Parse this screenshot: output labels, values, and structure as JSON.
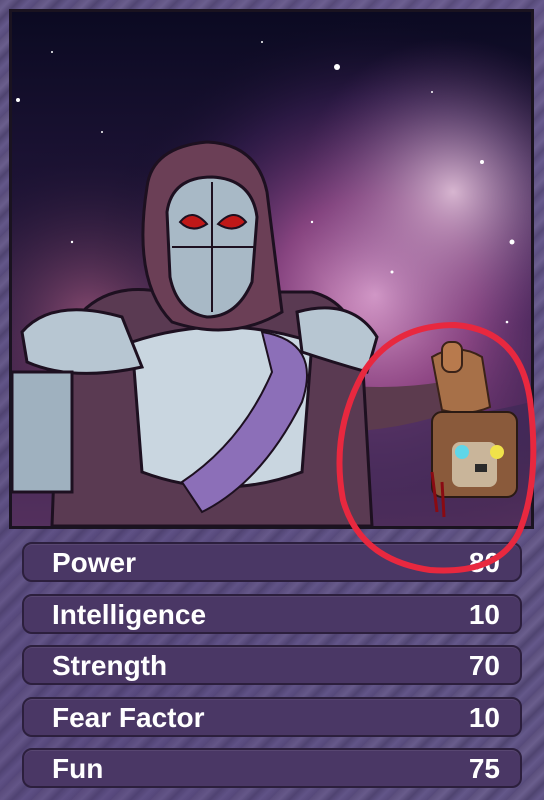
{
  "stats": [
    {
      "label": "Power",
      "value": "80"
    },
    {
      "label": "Intelligence",
      "value": "10"
    },
    {
      "label": "Strength",
      "value": "70"
    },
    {
      "label": "Fear Factor",
      "value": "10"
    },
    {
      "label": "Fun",
      "value": "75"
    }
  ],
  "colors": {
    "stat_row_bg": "#4a3765",
    "annotation_circle": "#e8283f",
    "eye_red": "#c01818"
  },
  "icons": {
    "character": "hooded-masked-warrior-icon",
    "trophy": "bear-head-trophy-icon"
  }
}
